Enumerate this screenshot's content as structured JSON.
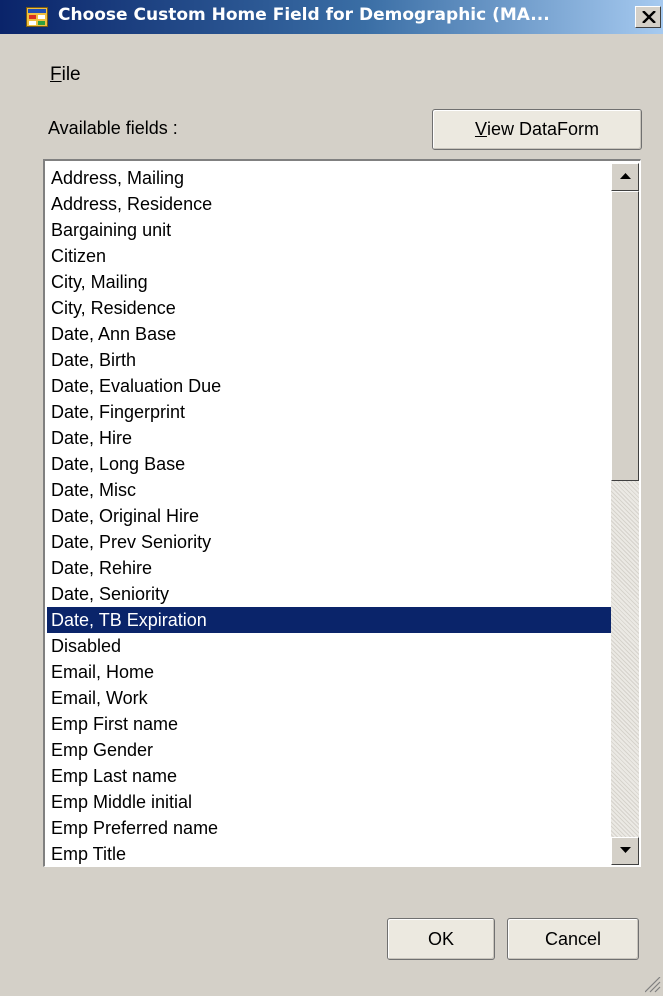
{
  "window": {
    "title": "Choose Custom Home Field for Demographic (MA...",
    "close_icon": "close-x-icon",
    "app_icon": "form-window-icon"
  },
  "menu": {
    "file_label_accel": "F",
    "file_label_rest": "ile"
  },
  "fields_panel": {
    "label": "Available fields :",
    "view_dataform_accel": "V",
    "view_dataform_rest": "iew DataForm",
    "items": [
      "Address, Mailing",
      "Address, Residence",
      "Bargaining unit",
      "Citizen",
      "City, Mailing",
      "City, Residence",
      "Date, Ann Base",
      "Date, Birth",
      "Date, Evaluation Due",
      "Date, Fingerprint",
      "Date, Hire",
      "Date, Long Base",
      "Date, Misc",
      "Date, Original Hire",
      "Date, Prev Seniority",
      "Date, Rehire",
      "Date, Seniority",
      "Date, TB Expiration",
      "Disabled",
      "Email, Home",
      "Email, Work",
      "Emp First name",
      "Emp Gender",
      "Emp Last name",
      "Emp Middle initial",
      "Emp Preferred name",
      "Emp Title"
    ],
    "selected_item": "Date, TB Expiration"
  },
  "buttons": {
    "ok": "OK",
    "cancel": "Cancel"
  },
  "colors": {
    "selection_bg": "#0a246a",
    "window_bg": "#d4d0c8"
  }
}
